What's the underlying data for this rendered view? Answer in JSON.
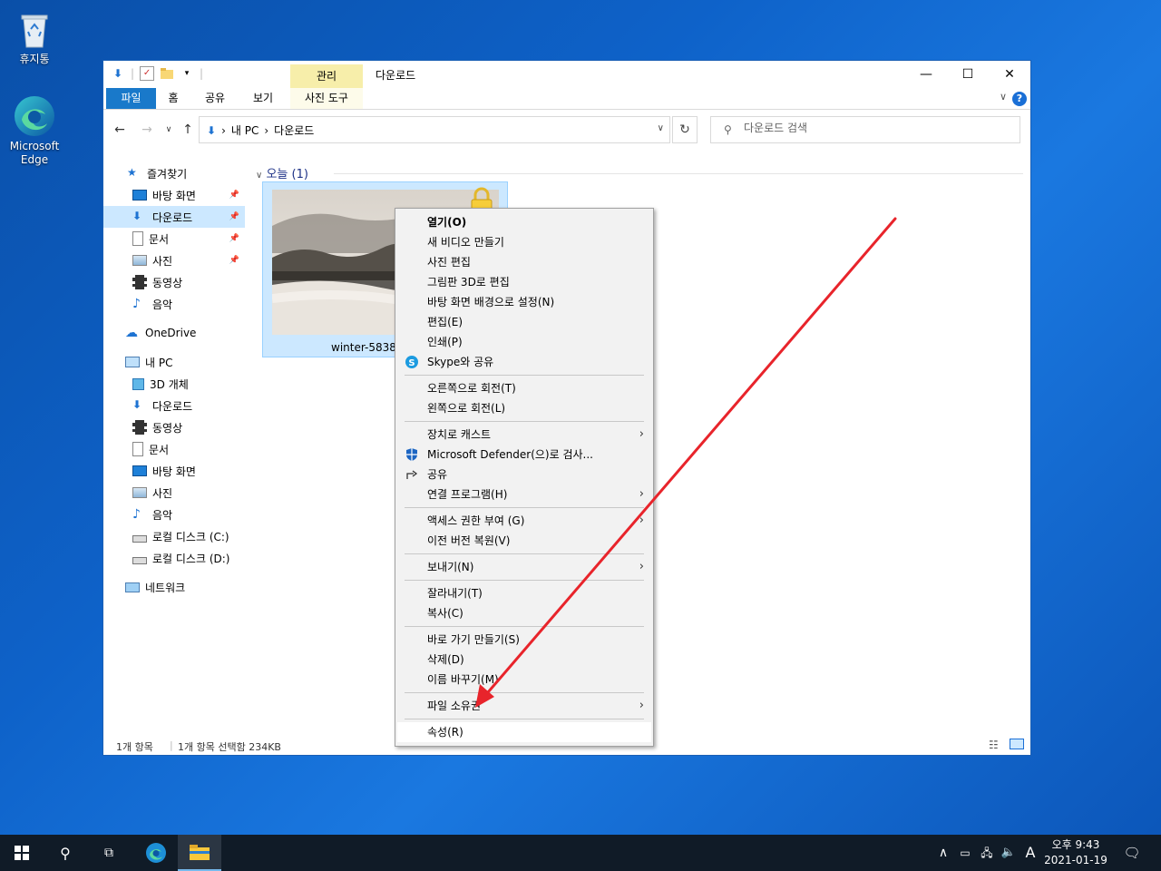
{
  "desktop": {
    "recycle_bin": "휴지통",
    "edge": "Microsoft Edge"
  },
  "window": {
    "title": "다운로드",
    "context_tab_header": "관리",
    "ribbon_tabs": [
      "파일",
      "홈",
      "공유",
      "보기",
      "사진 도구"
    ],
    "address": {
      "root": "내 PC",
      "current": "다운로드"
    },
    "search_placeholder": "다운로드 검색",
    "sidebar": {
      "quick_access": "즐겨찾기",
      "qa_items": [
        "바탕 화면",
        "다운로드",
        "문서",
        "사진",
        "동영상",
        "음악"
      ],
      "onedrive": "OneDrive",
      "this_pc": "내 PC",
      "pc_items": [
        "3D 개체",
        "다운로드",
        "동영상",
        "문서",
        "바탕 화면",
        "사진",
        "음악",
        "로컬 디스크 (C:)",
        "로컬 디스크 (D:)"
      ],
      "network": "네트워크"
    },
    "group_header": "오늘 (1)",
    "file_name": "winter-58389",
    "status": {
      "count": "1개 항목",
      "selected": "1개 항목 선택함 234KB"
    }
  },
  "context_menu": {
    "items": [
      {
        "label": "열기(O)",
        "bold": true
      },
      {
        "label": "새 비디오 만들기"
      },
      {
        "label": "사진 편집"
      },
      {
        "label": "그림판 3D로 편집"
      },
      {
        "label": "바탕 화면 배경으로 설정(N)"
      },
      {
        "label": "편집(E)"
      },
      {
        "label": "인쇄(P)"
      },
      {
        "label": "Skype와 공유",
        "icon": "skype-icon"
      },
      {
        "label": "오른쪽으로 회전(T)"
      },
      {
        "label": "왼쪽으로 회전(L)"
      },
      {
        "label": "장치로 캐스트",
        "submenu": true
      },
      {
        "label": "Microsoft Defender(으)로 검사...",
        "icon": "defender-icon"
      },
      {
        "label": "공유",
        "icon": "share-icon"
      },
      {
        "label": "연결 프로그램(H)",
        "submenu": true
      },
      {
        "label": "액세스 권한 부여 (G)",
        "submenu": true
      },
      {
        "label": "이전 버전 복원(V)"
      },
      {
        "label": "보내기(N)",
        "submenu": true
      },
      {
        "label": "잘라내기(T)"
      },
      {
        "label": "복사(C)"
      },
      {
        "label": "바로 가기 만들기(S)"
      },
      {
        "label": "삭제(D)"
      },
      {
        "label": "이름 바꾸기(M)"
      },
      {
        "label": "파일 소유권",
        "submenu": true
      },
      {
        "label": "속성(R)"
      }
    ]
  },
  "taskbar": {
    "clock_time": "오후 9:43",
    "clock_date": "2021-01-19",
    "ime": "A"
  },
  "colors": {
    "accent": "#1979ca",
    "selection": "#cce8ff",
    "annotation_arrow": "#e8242b"
  }
}
